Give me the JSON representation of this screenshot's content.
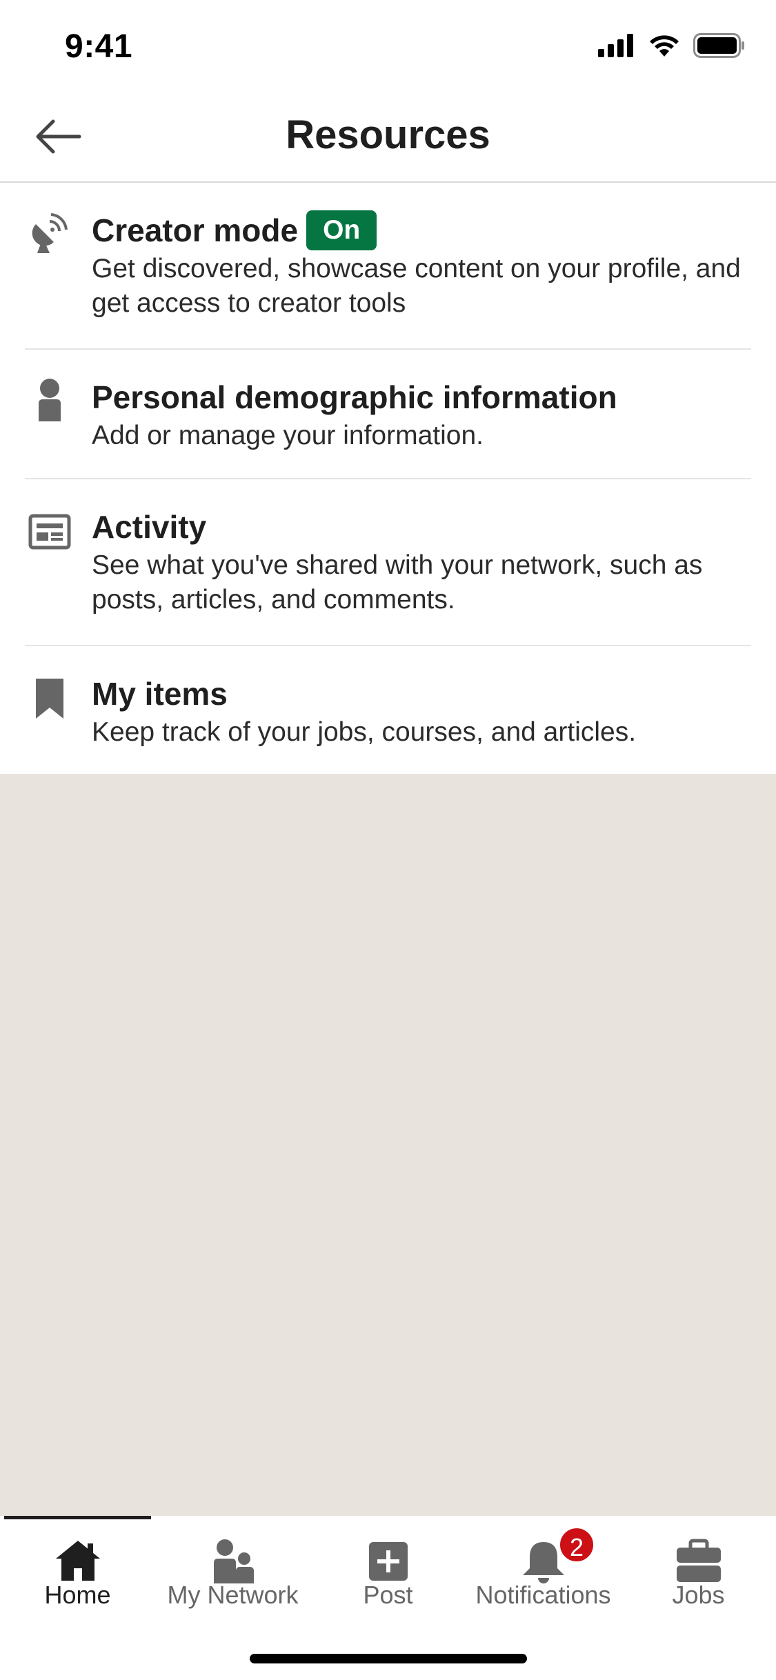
{
  "status_bar": {
    "time": "9:41"
  },
  "header": {
    "title": "Resources"
  },
  "items": [
    {
      "title": "Creator mode",
      "badge": "On",
      "description": "Get discovered, showcase content on your profile, and get access to creator tools",
      "icon": "satellite-dish-icon"
    },
    {
      "title": "Personal demographic information",
      "description": "Add or manage your information.",
      "icon": "person-icon"
    },
    {
      "title": "Activity",
      "description": "See what you've shared with your network, such as posts, articles, and comments.",
      "icon": "newspaper-icon"
    },
    {
      "title": "My items",
      "description": "Keep track of your jobs, courses, and articles.",
      "icon": "bookmark-icon"
    }
  ],
  "nav": [
    {
      "label": "Home",
      "icon": "home-icon",
      "active": true
    },
    {
      "label": "My Network",
      "icon": "network-icon"
    },
    {
      "label": "Post",
      "icon": "post-plus-icon"
    },
    {
      "label": "Notifications",
      "icon": "bell-icon",
      "badge": "2"
    },
    {
      "label": "Jobs",
      "icon": "briefcase-icon"
    }
  ],
  "colors": {
    "accent_green": "#057642",
    "badge_red": "#cc1016",
    "background": "#e8e3dd"
  }
}
